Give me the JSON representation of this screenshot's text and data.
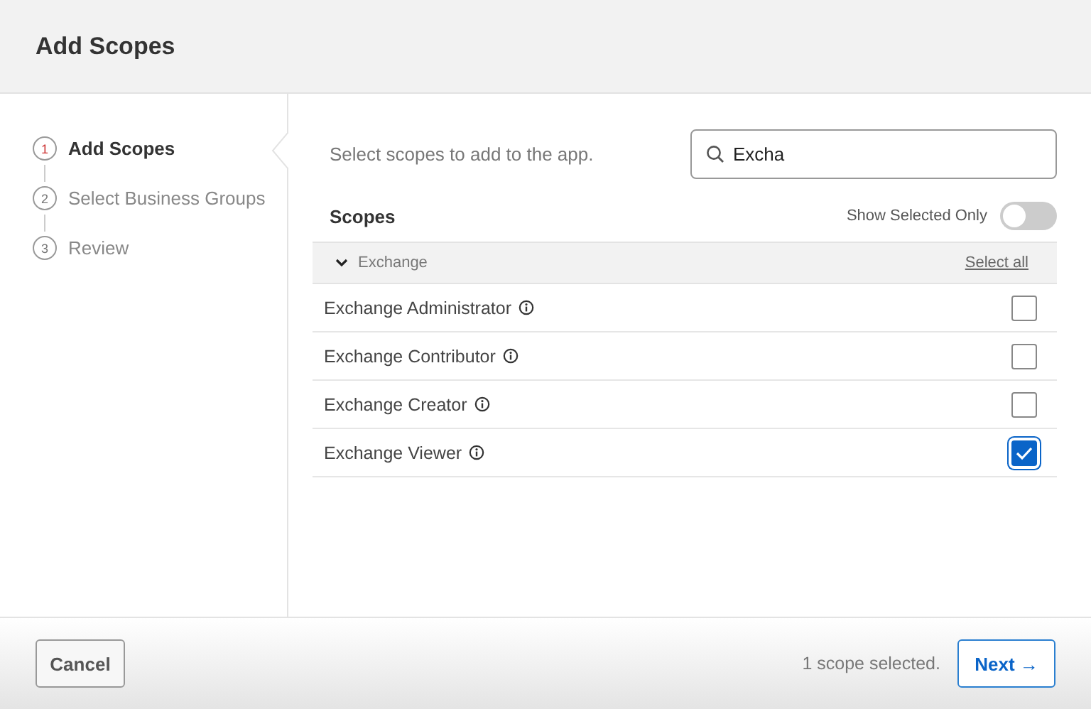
{
  "header": {
    "title": "Add Scopes"
  },
  "steps": [
    {
      "number": "1",
      "label": "Add Scopes",
      "selected": true
    },
    {
      "number": "2",
      "label": "Select Business Groups",
      "selected": false
    },
    {
      "number": "3",
      "label": "Review",
      "selected": false
    }
  ],
  "intro": "Select scopes to add to the app.",
  "search": {
    "value": "Excha"
  },
  "scopes_heading": "Scopes",
  "show_selected_only": {
    "label": "Show Selected Only",
    "on": false
  },
  "group": {
    "name": "Exchange",
    "expanded": true,
    "select_all": "Select all",
    "items": [
      {
        "label": "Exchange Administrator",
        "checked": false
      },
      {
        "label": "Exchange Contributor",
        "checked": false
      },
      {
        "label": "Exchange Creator",
        "checked": false
      },
      {
        "label": "Exchange Viewer",
        "checked": true
      }
    ]
  },
  "footer": {
    "cancel": "Cancel",
    "status": "1 scope selected.",
    "next": "Next →"
  }
}
